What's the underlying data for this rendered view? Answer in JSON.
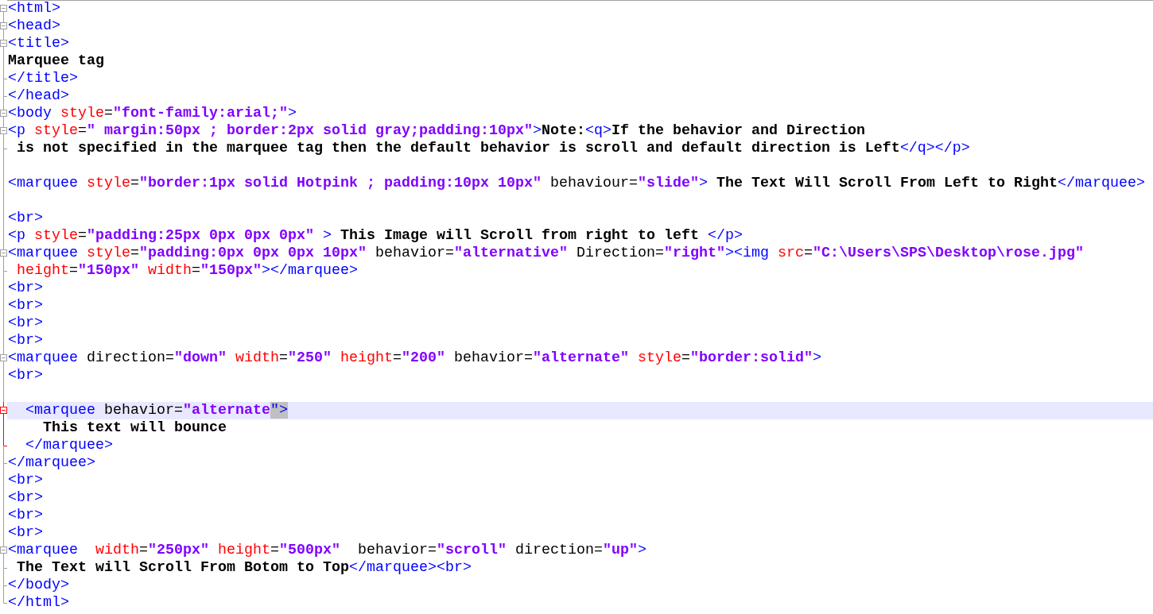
{
  "editor": {
    "lines": [
      {
        "kind": "box",
        "current": false,
        "selected": false,
        "tokens": [
          {
            "kind": "tag",
            "text": "<html>"
          }
        ]
      },
      {
        "kind": "box",
        "current": false,
        "selected": false,
        "tokens": [
          {
            "kind": "tag",
            "text": "<head>"
          }
        ]
      },
      {
        "kind": "box",
        "current": false,
        "selected": false,
        "tokens": [
          {
            "kind": "tag",
            "text": "<title>"
          }
        ]
      },
      {
        "kind": "line",
        "current": false,
        "selected": false,
        "tokens": [
          {
            "kind": "text",
            "text": "Marquee tag"
          }
        ]
      },
      {
        "kind": "end",
        "current": false,
        "selected": false,
        "tokens": [
          {
            "kind": "tag",
            "text": "</title>"
          }
        ]
      },
      {
        "kind": "end",
        "current": false,
        "selected": false,
        "tokens": [
          {
            "kind": "tag",
            "text": "</head>"
          }
        ]
      },
      {
        "kind": "box",
        "current": false,
        "selected": false,
        "tokens": [
          {
            "kind": "tag",
            "text": "<body"
          },
          {
            "kind": "attr",
            "text": " style"
          },
          {
            "kind": "plain",
            "text": "="
          },
          {
            "kind": "value",
            "text": "\"font-family:arial;\""
          },
          {
            "kind": "tag",
            "text": ">"
          }
        ]
      },
      {
        "kind": "box",
        "current": false,
        "selected": false,
        "tokens": [
          {
            "kind": "tag",
            "text": "<p"
          },
          {
            "kind": "attr",
            "text": " style"
          },
          {
            "kind": "plain",
            "text": "="
          },
          {
            "kind": "value",
            "text": "\" margin:50px ; border:2px solid gray;padding:10px\""
          },
          {
            "kind": "tag",
            "text": ">"
          },
          {
            "kind": "text",
            "text": "Note:"
          },
          {
            "kind": "tag",
            "text": "<q>"
          },
          {
            "kind": "text",
            "text": "If the behavior and Direction"
          }
        ]
      },
      {
        "kind": "end",
        "current": false,
        "selected": false,
        "tokens": [
          {
            "kind": "text",
            "text": " is not specified in the marquee tag then the default behavior is scroll and default direction is Left"
          },
          {
            "kind": "tag",
            "text": "</q></p>"
          }
        ]
      },
      {
        "kind": "line",
        "current": false,
        "selected": false
      },
      {
        "kind": "line",
        "current": false,
        "selected": false,
        "tokens": [
          {
            "kind": "tag",
            "text": "<marquee"
          },
          {
            "kind": "attr",
            "text": " style"
          },
          {
            "kind": "plain",
            "text": "="
          },
          {
            "kind": "value",
            "text": "\"border:1px solid Hotpink ; padding:10px 10px\""
          },
          {
            "kind": "plain",
            "text": " behaviour="
          },
          {
            "kind": "value",
            "text": "\"slide\""
          },
          {
            "kind": "tag",
            "text": ">"
          },
          {
            "kind": "text",
            "text": " The Text Will Scroll From Left to Right"
          },
          {
            "kind": "tag",
            "text": "</marquee>"
          }
        ]
      },
      {
        "kind": "line",
        "current": false,
        "selected": false
      },
      {
        "kind": "line",
        "current": false,
        "selected": false,
        "tokens": [
          {
            "kind": "tag",
            "text": "<br>"
          }
        ]
      },
      {
        "kind": "line",
        "current": false,
        "selected": false,
        "tokens": [
          {
            "kind": "tag",
            "text": "<p"
          },
          {
            "kind": "attr",
            "text": " style"
          },
          {
            "kind": "plain",
            "text": "="
          },
          {
            "kind": "value",
            "text": "\"padding:25px 0px 0px 0px\""
          },
          {
            "kind": "tag",
            "text": " >"
          },
          {
            "kind": "text",
            "text": " This Image will Scroll from right to left "
          },
          {
            "kind": "tag",
            "text": "</p>"
          }
        ]
      },
      {
        "kind": "box",
        "current": false,
        "selected": false,
        "tokens": [
          {
            "kind": "tag",
            "text": "<marquee"
          },
          {
            "kind": "attr",
            "text": " style"
          },
          {
            "kind": "plain",
            "text": "="
          },
          {
            "kind": "value",
            "text": "\"padding:0px 0px 0px 10px\""
          },
          {
            "kind": "plain",
            "text": " behavior="
          },
          {
            "kind": "value",
            "text": "\"alternative\""
          },
          {
            "kind": "plain",
            "text": " Direction="
          },
          {
            "kind": "value",
            "text": "\"right\""
          },
          {
            "kind": "tag",
            "text": "><img"
          },
          {
            "kind": "attr",
            "text": " src"
          },
          {
            "kind": "plain",
            "text": "="
          },
          {
            "kind": "value",
            "text": "\"C:\\Users\\SPS\\Desktop\\rose.jpg\""
          }
        ]
      },
      {
        "kind": "end",
        "current": false,
        "selected": false,
        "tokens": [
          {
            "kind": "attr",
            "text": " height"
          },
          {
            "kind": "plain",
            "text": "="
          },
          {
            "kind": "value",
            "text": "\"150px\""
          },
          {
            "kind": "attr",
            "text": " width"
          },
          {
            "kind": "plain",
            "text": "="
          },
          {
            "kind": "value",
            "text": "\"150px\""
          },
          {
            "kind": "tag",
            "text": "></marquee>"
          }
        ]
      },
      {
        "kind": "line",
        "current": false,
        "selected": false,
        "tokens": [
          {
            "kind": "tag",
            "text": "<br>"
          }
        ]
      },
      {
        "kind": "line",
        "current": false,
        "selected": false,
        "tokens": [
          {
            "kind": "tag",
            "text": "<br>"
          }
        ]
      },
      {
        "kind": "line",
        "current": false,
        "selected": false,
        "tokens": [
          {
            "kind": "tag",
            "text": "<br>"
          }
        ]
      },
      {
        "kind": "line",
        "current": false,
        "selected": false,
        "tokens": [
          {
            "kind": "tag",
            "text": "<br>"
          }
        ]
      },
      {
        "kind": "box",
        "current": false,
        "selected": false,
        "tokens": [
          {
            "kind": "tag",
            "text": "<marquee"
          },
          {
            "kind": "plain",
            "text": " direction="
          },
          {
            "kind": "value",
            "text": "\"down\""
          },
          {
            "kind": "attr",
            "text": " width"
          },
          {
            "kind": "plain",
            "text": "="
          },
          {
            "kind": "value",
            "text": "\"250\""
          },
          {
            "kind": "attr",
            "text": " height"
          },
          {
            "kind": "plain",
            "text": "="
          },
          {
            "kind": "value",
            "text": "\"200\""
          },
          {
            "kind": "plain",
            "text": " behavior="
          },
          {
            "kind": "value",
            "text": "\"alternate\""
          },
          {
            "kind": "attr",
            "text": " style"
          },
          {
            "kind": "plain",
            "text": "="
          },
          {
            "kind": "value",
            "text": "\"border:solid\""
          },
          {
            "kind": "tag",
            "text": ">"
          }
        ]
      },
      {
        "kind": "line",
        "current": false,
        "selected": false,
        "tokens": [
          {
            "kind": "tag",
            "text": "<br>"
          }
        ]
      },
      {
        "kind": "line",
        "current": false,
        "selected": false
      },
      {
        "kind": "box",
        "current": true,
        "selected": true,
        "tokens": [
          {
            "kind": "tag",
            "text": "  <marquee"
          },
          {
            "kind": "plain",
            "text": " behavior="
          },
          {
            "kind": "value",
            "text": "\"alternate"
          },
          {
            "kind": "match",
            "text": "\">"
          }
        ]
      },
      {
        "kind": "line",
        "current": true,
        "selected": false,
        "tokens": [
          {
            "kind": "text",
            "text": "    This text will bounce"
          }
        ]
      },
      {
        "kind": "end",
        "current": true,
        "selected": false,
        "tokens": [
          {
            "kind": "tag",
            "text": "  </marquee>"
          }
        ]
      },
      {
        "kind": "end",
        "current": false,
        "selected": false,
        "tokens": [
          {
            "kind": "tag",
            "text": "</marquee>"
          }
        ]
      },
      {
        "kind": "line",
        "current": false,
        "selected": false,
        "tokens": [
          {
            "kind": "tag",
            "text": "<br>"
          }
        ]
      },
      {
        "kind": "line",
        "current": false,
        "selected": false,
        "tokens": [
          {
            "kind": "tag",
            "text": "<br>"
          }
        ]
      },
      {
        "kind": "line",
        "current": false,
        "selected": false,
        "tokens": [
          {
            "kind": "tag",
            "text": "<br>"
          }
        ]
      },
      {
        "kind": "line",
        "current": false,
        "selected": false,
        "tokens": [
          {
            "kind": "tag",
            "text": "<br>"
          }
        ]
      },
      {
        "kind": "box",
        "current": false,
        "selected": false,
        "tokens": [
          {
            "kind": "tag",
            "text": "<marquee"
          },
          {
            "kind": "attr",
            "text": "  width"
          },
          {
            "kind": "plain",
            "text": "="
          },
          {
            "kind": "value",
            "text": "\"250px\""
          },
          {
            "kind": "attr",
            "text": " height"
          },
          {
            "kind": "plain",
            "text": "="
          },
          {
            "kind": "value",
            "text": "\"500px\""
          },
          {
            "kind": "plain",
            "text": "  behavior="
          },
          {
            "kind": "value",
            "text": "\"scroll\""
          },
          {
            "kind": "plain",
            "text": " direction="
          },
          {
            "kind": "value",
            "text": "\"up\""
          },
          {
            "kind": "tag",
            "text": ">"
          }
        ]
      },
      {
        "kind": "end",
        "current": false,
        "selected": false,
        "tokens": [
          {
            "kind": "text",
            "text": " The Text will Scroll From Botom to Top"
          },
          {
            "kind": "tag",
            "text": "</marquee><br>"
          }
        ]
      },
      {
        "kind": "end",
        "current": false,
        "selected": false,
        "tokens": [
          {
            "kind": "tag",
            "text": "</body>"
          }
        ]
      },
      {
        "kind": "end",
        "current": false,
        "selected": false,
        "tokens": [
          {
            "kind": "tag",
            "text": "</html>"
          }
        ]
      }
    ]
  }
}
